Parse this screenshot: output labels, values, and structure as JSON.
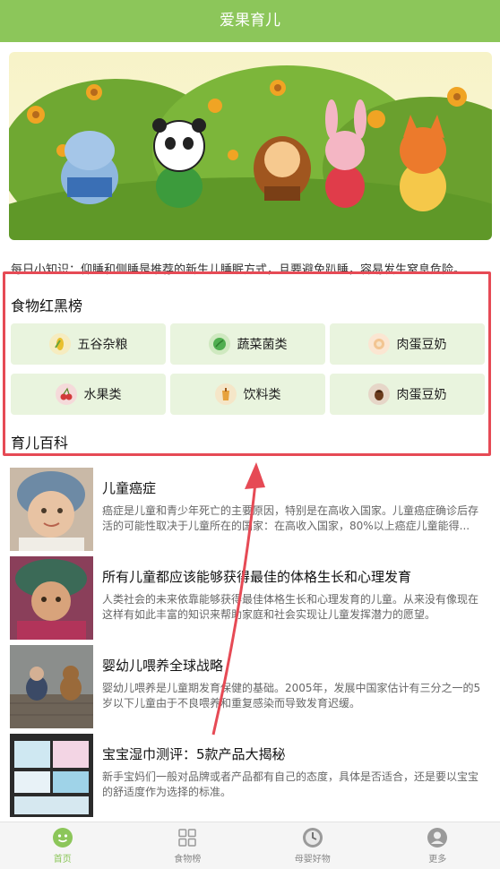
{
  "header": {
    "title": "爱果育儿"
  },
  "tip": {
    "text": "每日小知识：仰睡和侧睡是推荐的新生儿睡眠方式，且要避免趴睡，容易发生窒息危险。"
  },
  "food_rank": {
    "title": "食物红黑榜",
    "categories": [
      {
        "label": "五谷杂粮",
        "icon": "grain-icon",
        "color": "#f1d66a"
      },
      {
        "label": "蔬菜菌类",
        "icon": "vegetable-icon",
        "color": "#5cb85c"
      },
      {
        "label": "肉蛋豆奶",
        "icon": "meat-egg-icon",
        "color": "#f3c79a"
      },
      {
        "label": "水果类",
        "icon": "cherry-icon",
        "color": "#d9534f"
      },
      {
        "label": "饮料类",
        "icon": "drink-icon",
        "color": "#e8a640"
      },
      {
        "label": "肉蛋豆奶",
        "icon": "nut-icon",
        "color": "#7a4a2a"
      }
    ]
  },
  "encyclopedia": {
    "title": "育儿百科",
    "articles": [
      {
        "title": "儿童癌症",
        "desc": "癌症是儿童和青少年死亡的主要原因，特别是在高收入国家。儿童癌症确诊后存活的可能性取决于儿童所在的国家：在高收入国家，80%以上癌症儿童能得..."
      },
      {
        "title": "所有儿童都应该能够获得最佳的体格生长和心理发育",
        "desc": "人类社会的未来依靠能够获得最佳体格生长和心理发育的儿童。从来没有像现在这样有如此丰富的知识来帮助家庭和社会实现让儿童发挥潜力的愿望。"
      },
      {
        "title": "婴幼儿喂养全球战略",
        "desc": " 婴幼儿喂养是儿童期发育保健的基础。2005年，发展中国家估计有三分之一的5岁以下儿童由于不良喂养和重复感染而导致发育迟缓。"
      },
      {
        "title": "宝宝湿巾测评：5款产品大揭秘",
        "desc": "新手宝妈们一般对品牌或者产品都有自己的态度，具体是否适合，还是要以宝宝的舒适度作为选择的标准。"
      }
    ]
  },
  "tabbar": {
    "items": [
      {
        "label": "首页",
        "icon": "home-icon",
        "active": true
      },
      {
        "label": "食物榜",
        "icon": "grid-icon"
      },
      {
        "label": "母婴好物",
        "icon": "clock-icon"
      },
      {
        "label": "更多",
        "icon": "user-icon"
      }
    ]
  },
  "colors": {
    "accent": "#8cc65a",
    "highlight_box": "#e64a55",
    "category_bg": "#e9f4de"
  }
}
